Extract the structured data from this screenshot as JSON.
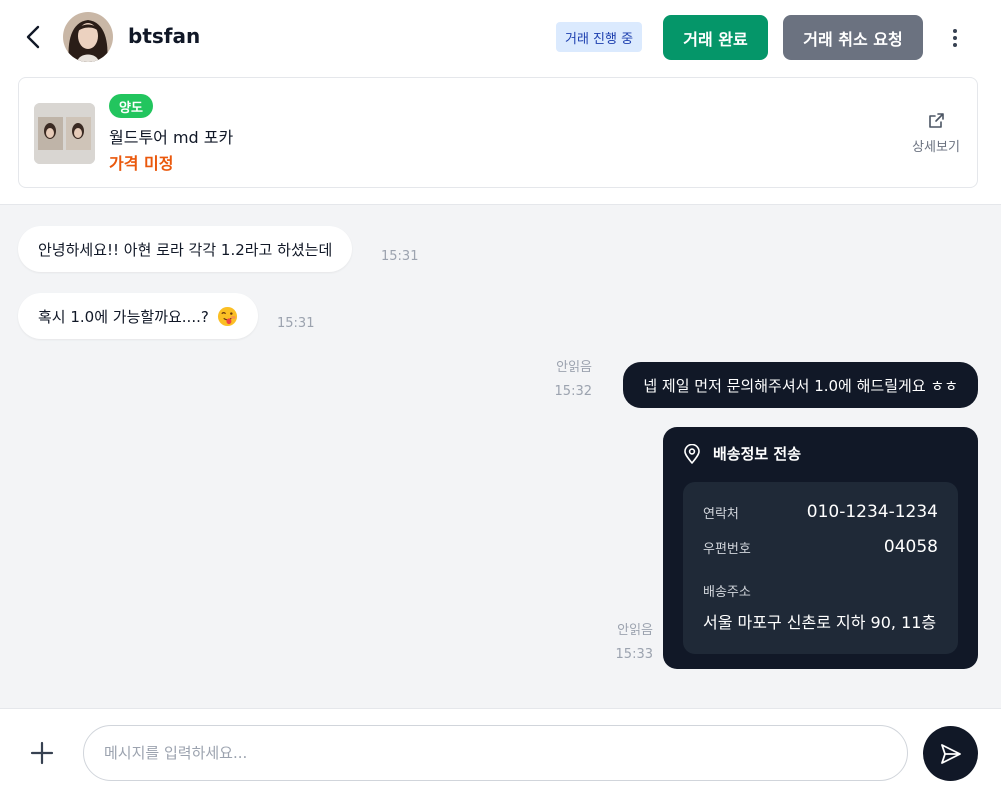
{
  "header": {
    "username": "btsfan",
    "status_badge": "거래 진행 중",
    "complete_button": "거래 완료",
    "cancel_button": "거래 취소 요청",
    "back_icon": "chevron-left-icon",
    "more_icon": "more-vertical-icon"
  },
  "product": {
    "tag": "양도",
    "title": "월드투어 md 포카",
    "price": "가격 미정",
    "detail_label": "상세보기",
    "detail_icon": "external-link-icon"
  },
  "messages": [
    {
      "direction": "incoming",
      "text": "안녕하세요!! 아현 로라 각각 1.2라고 하셨는데",
      "time": "15:31"
    },
    {
      "direction": "incoming",
      "text": "혹시 1.0에 가능할까요....?",
      "emoji": "winking-face-with-tongue",
      "time": "15:31"
    },
    {
      "direction": "outgoing",
      "text": "넵 제일 먼저 문의해주셔서 1.0에 해드릴게요 ㅎㅎ",
      "read_status": "안읽음",
      "time": "15:32"
    },
    {
      "direction": "outgoing",
      "type": "shipping_info",
      "read_status": "안읽음",
      "time": "15:33",
      "title": "배송정보 전송",
      "icon": "map-pin-icon",
      "contact_label": "연락처",
      "contact_value": "010-1234-1234",
      "postal_label": "우편번호",
      "postal_value": "04058",
      "address_label": "배송주소",
      "address_value": "서울 마포구 신촌로 지하 90, 11층"
    }
  ],
  "input": {
    "placeholder": "메시지를 입력하세요...",
    "value": "",
    "plus_icon": "plus-icon",
    "send_icon": "send-icon"
  },
  "colors": {
    "complete_button": "#059669",
    "cancel_button": "#6b7280",
    "status_badge_bg": "#dbeafe",
    "status_badge_text": "#1e40af",
    "trade_tag": "#22c55e",
    "price": "#ea580c",
    "outgoing_bubble": "#111827",
    "page_background": "#f3f4f6"
  }
}
